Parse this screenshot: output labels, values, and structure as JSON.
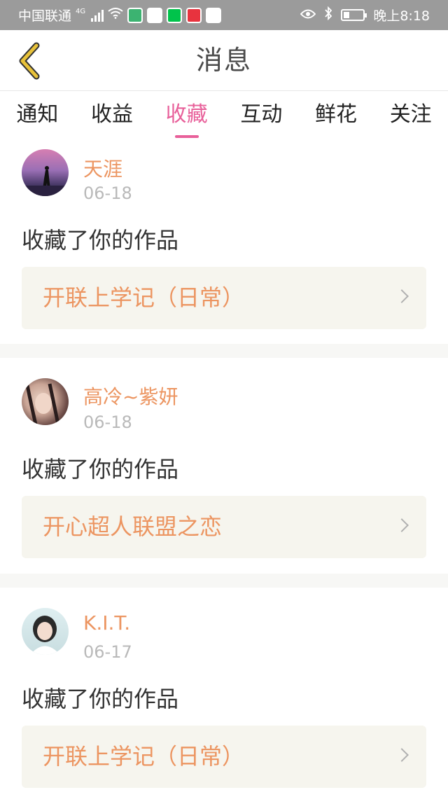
{
  "status_bar": {
    "carrier": "中国联通",
    "network": "4G",
    "time": "晚上8:18",
    "battery_level": 0.3,
    "icons": [
      "signal-icon",
      "wifi-icon",
      "video-app-icon",
      "sina-app-icon",
      "iqiyi-app-icon",
      "xiaohongshu-app-icon",
      "video-player-app-icon",
      "eye-icon",
      "bluetooth-icon",
      "battery-icon"
    ]
  },
  "header": {
    "title": "消息",
    "back_icon": "chevron-left-icon",
    "accent_color": "#e8c23a"
  },
  "tabs": [
    {
      "label": "通知",
      "active": false
    },
    {
      "label": "收益",
      "active": false
    },
    {
      "label": "收藏",
      "active": true
    },
    {
      "label": "互动",
      "active": false
    },
    {
      "label": "鲜花",
      "active": false
    },
    {
      "label": "关注",
      "active": false
    }
  ],
  "colors": {
    "active_tab": "#e8609a",
    "user_name": "#ec9561",
    "work_title": "#ec9561",
    "date": "#b9b9b9",
    "card_link_bg": "#f6f5ee"
  },
  "messages": [
    {
      "user": "天涯",
      "date": "06-18",
      "action": "收藏了你的作品",
      "work": "开联上学记（日常）",
      "avatar": "avatar-sunset"
    },
    {
      "user": "高冷~紫妍",
      "date": "06-18",
      "action": "收藏了你的作品",
      "work": "开心超人联盟之恋",
      "avatar": "avatar-braids"
    },
    {
      "user": "K.I.T.",
      "date": "06-17",
      "action": "收藏了你的作品",
      "work": "开联上学记（日常）",
      "avatar": "avatar-portrait"
    }
  ]
}
